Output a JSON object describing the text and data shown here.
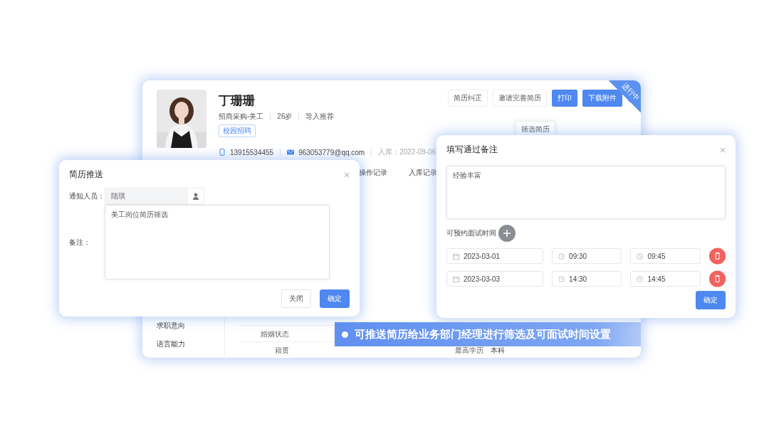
{
  "profile": {
    "name": "丁珊珊",
    "meta": [
      "招商采购-美工",
      "26岁",
      "导入推荐"
    ],
    "tag": "校园招聘",
    "phone": "13915534455",
    "email": "963053779@qq.com",
    "entry_date": "入库：2022-09-06"
  },
  "actions": [
    {
      "label": "简历纠正",
      "primary": false
    },
    {
      "label": "邀请完善简历",
      "primary": false
    },
    {
      "label": "打印",
      "primary": true
    },
    {
      "label": "下载附件",
      "primary": true
    }
  ],
  "status_ribbon": "进行中",
  "screen_button": "筛选简历",
  "tabs": [
    {
      "label": "操作记录",
      "selected": false
    },
    {
      "label": "入库记录",
      "selected": false
    }
  ],
  "sidebar": {
    "items": [
      "求职意向",
      "语言能力"
    ]
  },
  "details": [
    {
      "label": "婚姻状态"
    },
    {
      "label": "籍贯",
      "right_label": "最高学历",
      "right_value": "本科"
    }
  ],
  "push_dialog": {
    "title": "简历推送",
    "notify_label": "通知人员：",
    "notify_value": "陆琪",
    "remark_label": "备注：",
    "remark_value": "美工岗位简历筛选",
    "buttons": [
      {
        "label": "关闭",
        "primary": false
      },
      {
        "label": "确定",
        "primary": true
      }
    ]
  },
  "pass_dialog": {
    "title": "填写通过备注",
    "remark_value": "经验丰富",
    "slots_label": "可预约面试时间",
    "slots": [
      {
        "date": "2023-03-01",
        "start": "09:30",
        "end": "09:45"
      },
      {
        "date": "2023-03-03",
        "start": "14:30",
        "end": "14:45"
      }
    ],
    "confirm": "确定"
  },
  "caption": "可推送简历给业务部门经理进行筛选及可面试时间设置"
}
